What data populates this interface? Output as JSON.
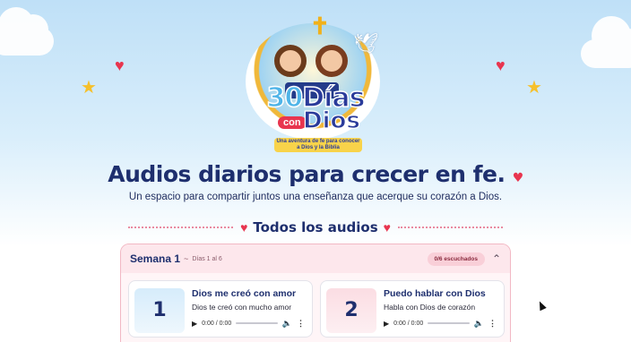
{
  "logo": {
    "number": "30",
    "title_word": "Días",
    "connector": "con",
    "title_end": "Dios",
    "tagline": "Una aventura de fe para conocer a Dios y la Biblia"
  },
  "hero": {
    "headline": "Audios diarios para crecer en fe.",
    "subtitle": "Un espacio para compartir juntos una enseñanza que acerque su corazón a Dios."
  },
  "section": {
    "title": "Todos los audios"
  },
  "week": {
    "name": "Semana 1",
    "separator": "~",
    "days": "Días 1 al 6",
    "badge": "0/6 escuchados",
    "cards": [
      {
        "number": "1",
        "title": "Dios me creó con amor",
        "desc": "Dios te creó con mucho amor",
        "time": "0:00 / 0:00"
      },
      {
        "number": "2",
        "title": "Puedo hablar con Dios",
        "desc": "Habla con Dios de corazón",
        "time": "0:00 / 0:00"
      }
    ]
  },
  "colors": {
    "accent": "#e8354f",
    "navy": "#1e2f6e",
    "gold": "#f6c02b",
    "sky": "#bfe0f7"
  },
  "icons": [
    "heart-icon",
    "star-icon",
    "cross-icon",
    "dove-icon",
    "chevron-up-icon",
    "play-icon",
    "volume-icon",
    "more-icon"
  ]
}
